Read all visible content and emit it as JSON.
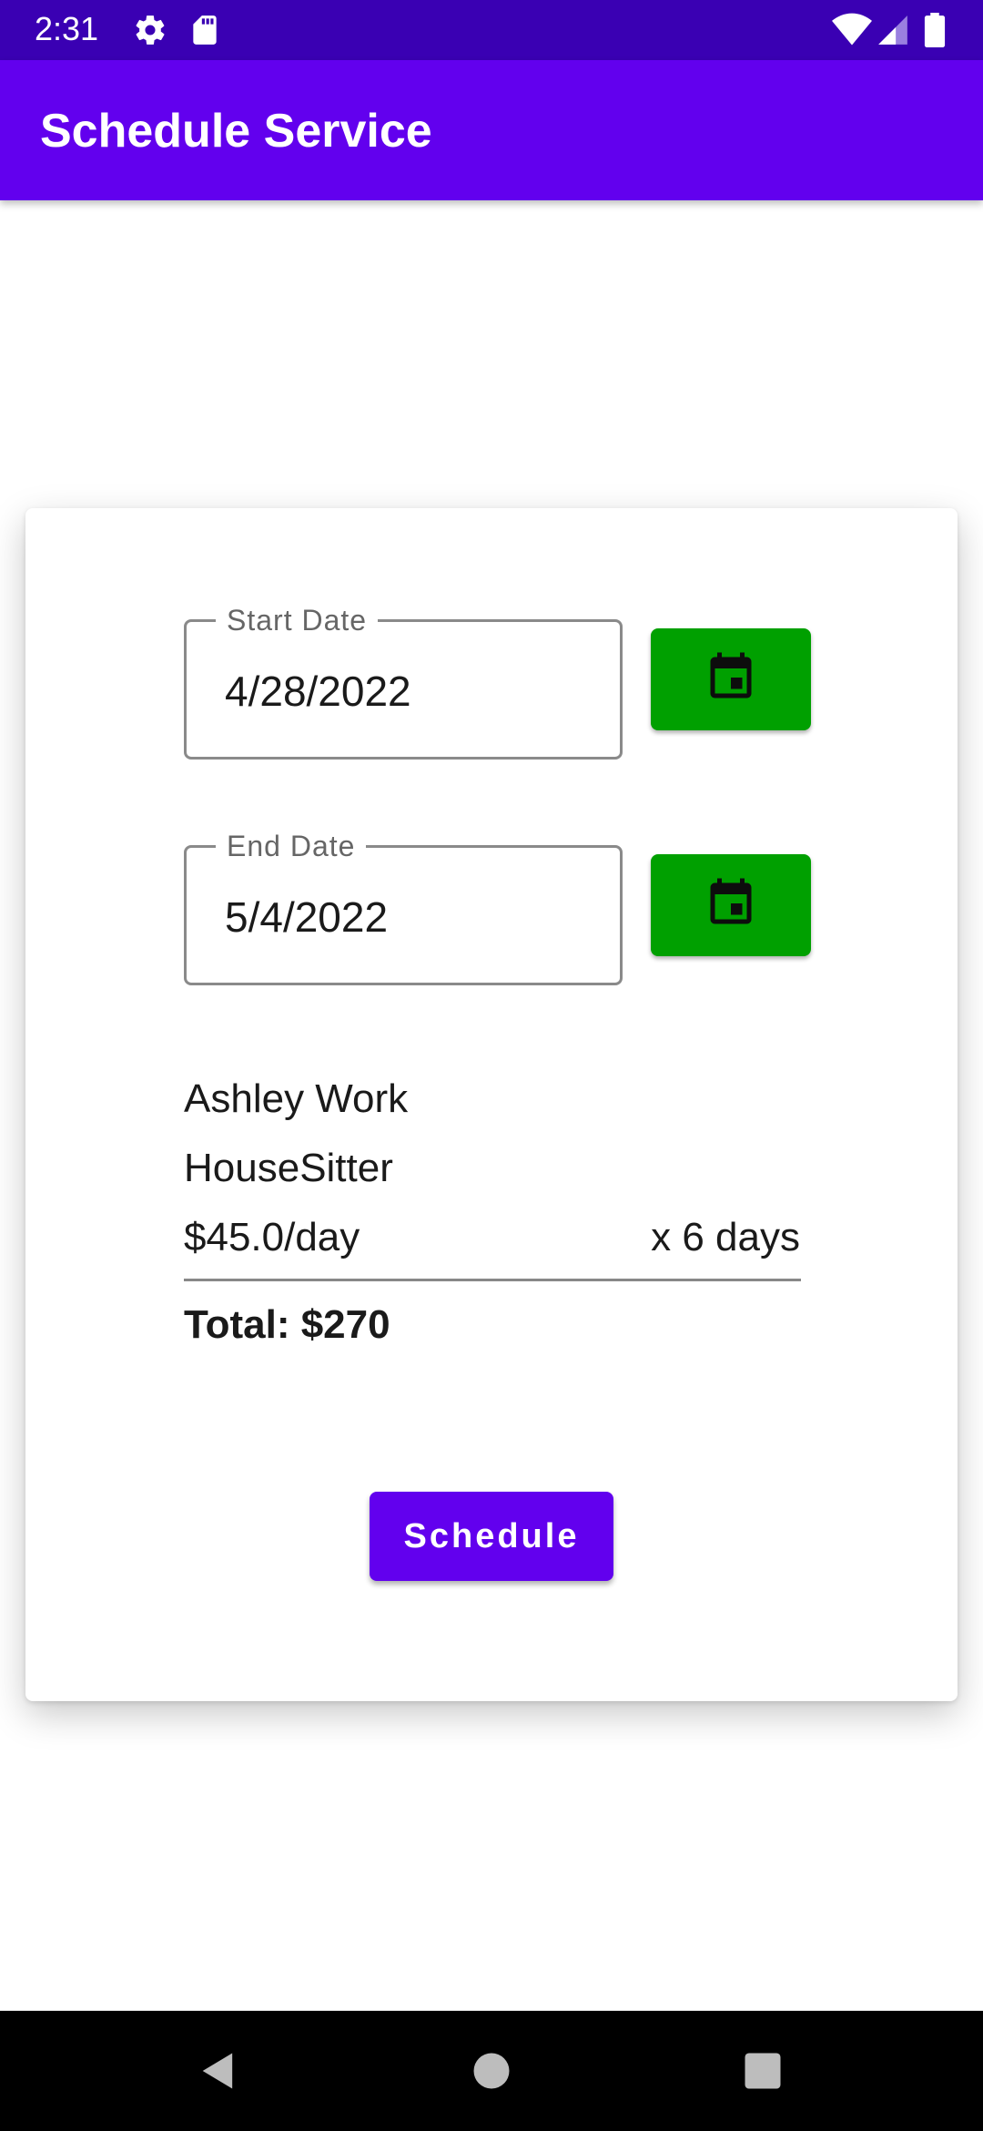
{
  "status_bar": {
    "time": "2:31",
    "icons": [
      "gear-icon",
      "sd-card-icon",
      "wifi-icon",
      "signal-icon",
      "battery-icon"
    ]
  },
  "app_bar": {
    "title": "Schedule Service"
  },
  "form": {
    "start_date": {
      "label": "Start Date",
      "value": "4/28/2022"
    },
    "end_date": {
      "label": "End Date",
      "value": "5/4/2022"
    },
    "calendar_icon": "calendar-icon"
  },
  "summary": {
    "provider_name": "Ashley Work",
    "service_type": "HouseSitter",
    "rate": "$45.0/day",
    "days": "x 6 days",
    "total": "Total: $270"
  },
  "actions": {
    "schedule_label": "Schedule"
  },
  "nav_bar": {
    "icons": [
      "back-icon",
      "home-icon",
      "recents-icon"
    ]
  },
  "colors": {
    "status_bar": "#3a00b3",
    "primary": "#6200ee",
    "calendar_button": "#00a000"
  }
}
